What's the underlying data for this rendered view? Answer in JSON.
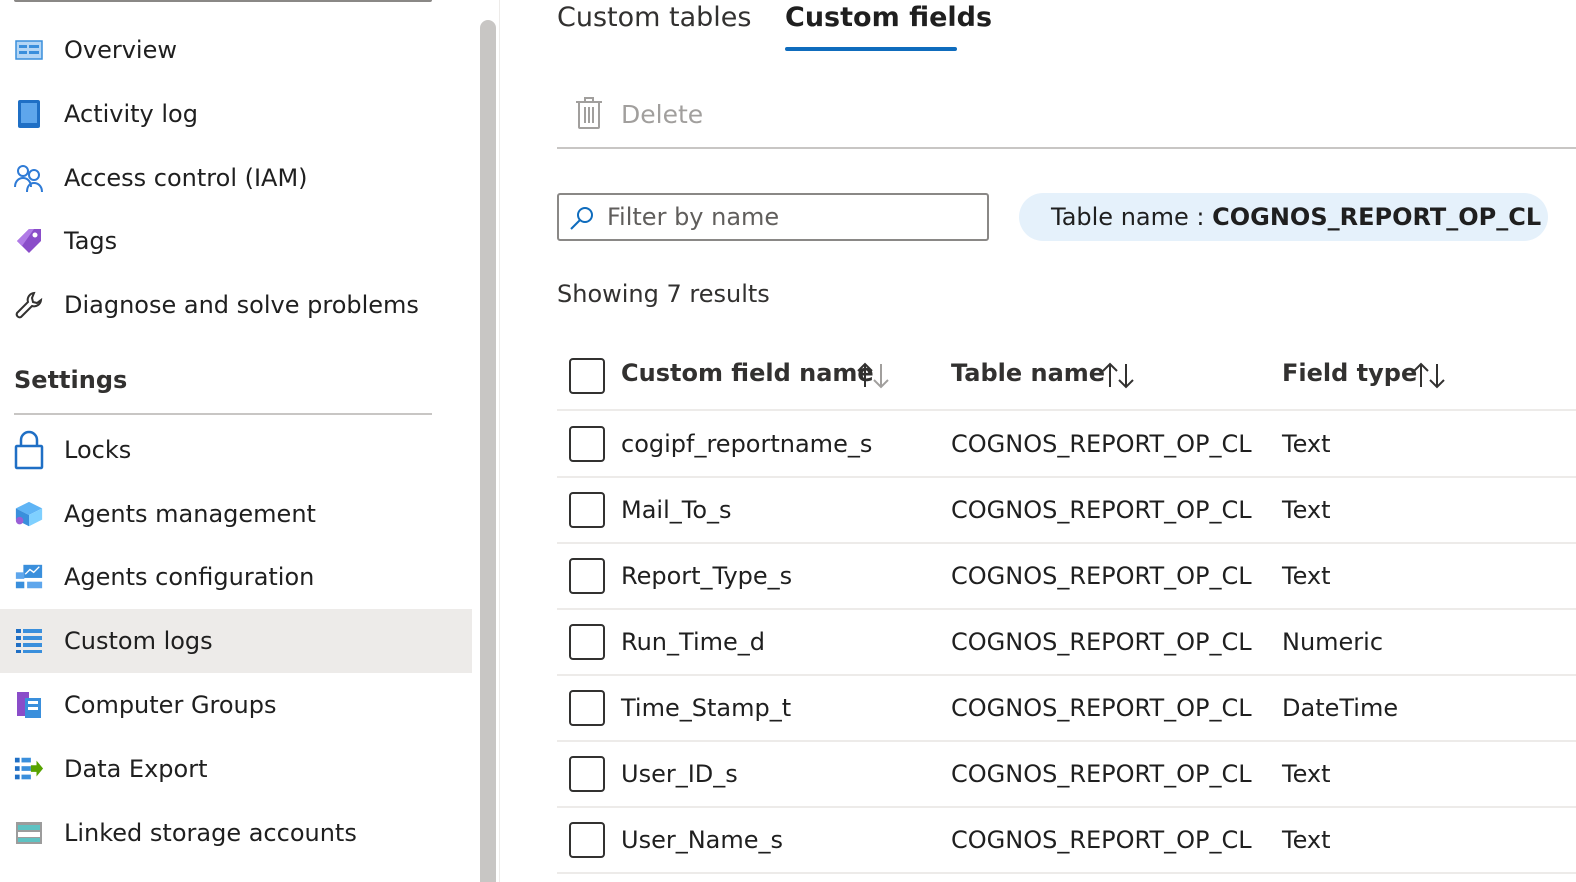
{
  "sidebar": {
    "items": [
      {
        "label": "Overview",
        "icon": "overview-icon"
      },
      {
        "label": "Activity log",
        "icon": "activity-log-icon"
      },
      {
        "label": "Access control (IAM)",
        "icon": "people-icon"
      },
      {
        "label": "Tags",
        "icon": "tag-icon"
      },
      {
        "label": "Diagnose and solve problems",
        "icon": "wrench-icon"
      }
    ],
    "section_title": "Settings",
    "settings_items": [
      {
        "label": "Locks",
        "icon": "lock-icon"
      },
      {
        "label": "Agents management",
        "icon": "agents-management-icon"
      },
      {
        "label": "Agents configuration",
        "icon": "agents-configuration-icon"
      },
      {
        "label": "Custom logs",
        "icon": "custom-logs-icon",
        "selected": true
      },
      {
        "label": "Computer Groups",
        "icon": "computer-groups-icon"
      },
      {
        "label": "Data Export",
        "icon": "data-export-icon"
      },
      {
        "label": "Linked storage accounts",
        "icon": "storage-icon"
      }
    ]
  },
  "tabs": [
    {
      "label": "Custom tables",
      "active": false
    },
    {
      "label": "Custom fields",
      "active": true
    }
  ],
  "toolbar": {
    "delete_label": "Delete"
  },
  "filter": {
    "placeholder": "Filter by name",
    "value": ""
  },
  "pill": {
    "label": "Table name : ",
    "value": "COGNOS_REPORT_OP_CL"
  },
  "results": {
    "text": "Showing 7 results"
  },
  "table": {
    "columns": [
      "Custom field name",
      "Table name",
      "Field type"
    ],
    "rows": [
      {
        "name": "cogipf_reportname_s",
        "table": "COGNOS_REPORT_OP_CL",
        "type": "Text"
      },
      {
        "name": "Mail_To_s",
        "table": "COGNOS_REPORT_OP_CL",
        "type": "Text"
      },
      {
        "name": "Report_Type_s",
        "table": "COGNOS_REPORT_OP_CL",
        "type": "Text"
      },
      {
        "name": "Run_Time_d",
        "table": "COGNOS_REPORT_OP_CL",
        "type": "Numeric"
      },
      {
        "name": "Time_Stamp_t",
        "table": "COGNOS_REPORT_OP_CL",
        "type": "DateTime"
      },
      {
        "name": "User_ID_s",
        "table": "COGNOS_REPORT_OP_CL",
        "type": "Text"
      },
      {
        "name": "User_Name_s",
        "table": "COGNOS_REPORT_OP_CL",
        "type": "Text"
      }
    ]
  },
  "colors": {
    "accent": "#0f6cbd",
    "selected_bg": "#edebe9",
    "pill_bg": "#e5f1fb"
  }
}
